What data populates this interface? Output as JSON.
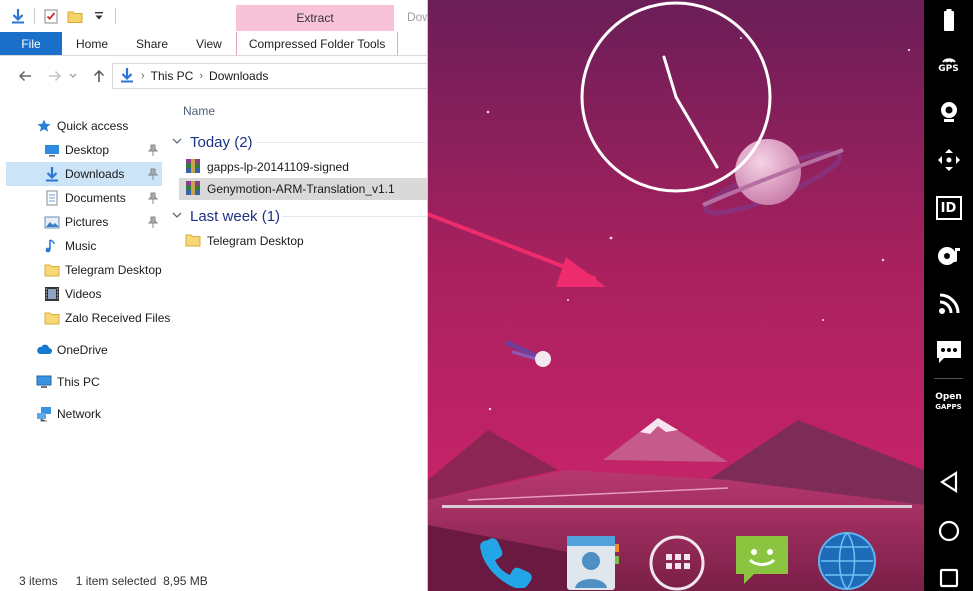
{
  "explorer": {
    "ribbon": {
      "tabs": {
        "file": "File",
        "home": "Home",
        "share": "Share",
        "view": "View"
      },
      "contextual_group_label": "Extract",
      "contextual_tab": "Compressed Folder Tools",
      "title_fragment": "Dow"
    },
    "breadcrumb": [
      "This PC",
      "Downloads"
    ],
    "nav_pane": {
      "quick_access": "Quick access",
      "pinned": [
        {
          "label": "Desktop",
          "icon": "desktop-icon"
        },
        {
          "label": "Downloads",
          "icon": "download-arrow-icon",
          "selected": true
        },
        {
          "label": "Documents",
          "icon": "documents-icon"
        },
        {
          "label": "Pictures",
          "icon": "pictures-icon"
        }
      ],
      "others": [
        {
          "label": "Music",
          "icon": "music-note-icon"
        },
        {
          "label": "Telegram Desktop",
          "icon": "folder-icon"
        },
        {
          "label": "Videos",
          "icon": "film-icon"
        },
        {
          "label": "Zalo Received Files",
          "icon": "folder-icon"
        }
      ],
      "onedrive": "OneDrive",
      "this_pc": "This PC",
      "network": "Network"
    },
    "content": {
      "column_header": "Name",
      "groups": [
        {
          "title": "Today (2)",
          "items": [
            {
              "name": "gapps-lp-20141109-signed",
              "icon": "winrar-archive-icon",
              "selected": false
            },
            {
              "name": "Genymotion-ARM-Translation_v1.1",
              "icon": "winrar-archive-icon",
              "selected": true
            }
          ]
        },
        {
          "title": "Last week (1)",
          "items": [
            {
              "name": "Telegram Desktop",
              "icon": "folder-icon",
              "selected": false
            }
          ]
        }
      ]
    },
    "status": {
      "items": "3 items",
      "selection": "1 item selected  8,95 MB"
    }
  },
  "emulator": {
    "wallpaper_colors": {
      "sky_top": "#6b1e58",
      "sky_mid": "#a8215e",
      "sky_bottom": "#d4246e",
      "accent_arrow": "#ee2b6c"
    },
    "clock_widget": "analog-clock",
    "dock_apps": [
      "phone-icon",
      "contacts-icon",
      "app-drawer-icon",
      "messaging-icon",
      "browser-globe-icon"
    ],
    "toolbar": {
      "gps_label": "GPS",
      "id_label": "ID",
      "opengapps_label_line1": "Open",
      "opengapps_label_line2": "GAPPS"
    }
  }
}
